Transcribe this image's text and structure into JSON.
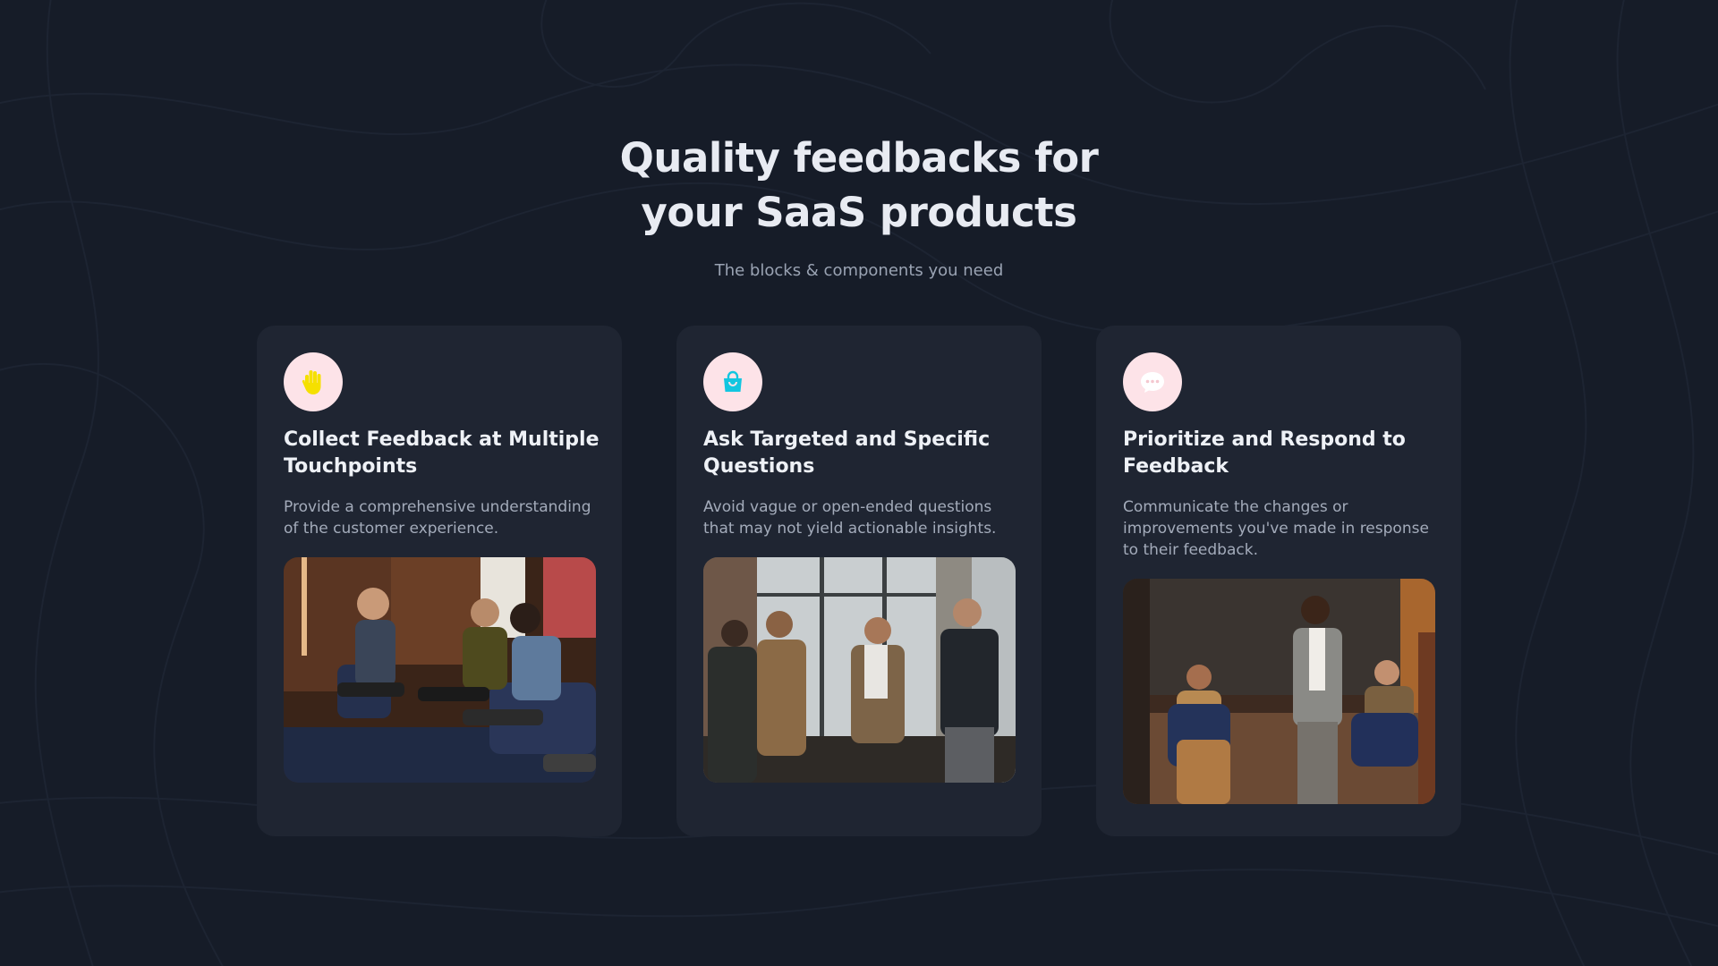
{
  "section": {
    "heading_line1": "Quality feedbacks for",
    "heading_line2": "your SaaS products",
    "subheading": "The blocks & components you need"
  },
  "cards": [
    {
      "icon": "raised-hand-icon",
      "icon_color": "#f5e000",
      "title": "Collect Feedback at Multiple Touchpoints",
      "description": "Provide a comprehensive understanding of the customer experience.",
      "image": "people-seated-in-discussion-photo"
    },
    {
      "icon": "shopping-bag-icon",
      "icon_color": "#12c6e0",
      "title": "Ask Targeted and Specific Questions",
      "description": "Avoid vague or open-ended questions that may not yield actionable insights.",
      "image": "men-talking-by-window-photo"
    },
    {
      "icon": "chat-bubble-icon",
      "icon_color": "#ffffff",
      "title": "Prioritize and Respond to Feedback",
      "description": "Communicate the changes or improvements you've made in response to their feedback.",
      "image": "speaker-with-microphone-photo"
    }
  ],
  "colors": {
    "background": "#161c28",
    "card": "#1f2532",
    "icon_circle": "#fde3e8"
  }
}
